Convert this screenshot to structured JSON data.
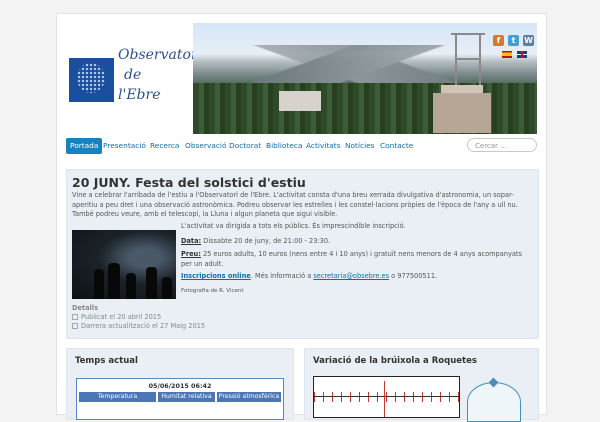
{
  "banner": {
    "logo_lines": [
      "Observatori",
      "de",
      "l'Ebre"
    ],
    "social": [
      {
        "icon": "facebook-icon",
        "glyph": "f",
        "color": "#d9772a"
      },
      {
        "icon": "twitter-icon",
        "glyph": "t",
        "color": "#3fa0d6"
      },
      {
        "icon": "wordpress-icon",
        "glyph": "W",
        "color": "#5a7f9e"
      }
    ],
    "languages": [
      {
        "icon": "flag-spanish-icon"
      },
      {
        "icon": "flag-english-icon"
      }
    ]
  },
  "nav": {
    "items": [
      "Portada",
      "Presentació",
      "Recerca",
      "Observació",
      "Doctorat",
      "Biblioteca",
      "Activitats",
      "Notícies",
      "Contacte"
    ],
    "active": "Portada",
    "search_placeholder": "Cercar ..."
  },
  "article": {
    "title": "20 JUNY. Festa del solstici d'estiu",
    "intro": "Vine a celebrar l'arribada de l'estiu a l'Observatori de l'Ebre. L'activitat consta d'una breu xerrada divulgativa d'astronomia, un sopar-aperitiu a peu dret i una observació astronòmica. Podreu observar les estrelles i les constel·lacions pròpies de l'època de l'any a ull nu. També podreu veure, amb el telescopi, la Lluna i algun planeta que sigui visible.",
    "line_public": "L'activitat va dirigida a tots els públics. És imprescindible inscripció.",
    "date_label": "Data:",
    "date_value": " Dissabte 20 de juny, de 21:00 - 23:30.",
    "price_label": "Preu:",
    "price_value": " 25 euros adults, 10 euros (nens entre 4 i 10 anys) i gratuït nens menors de 4 anys acompanyats per un adult.",
    "signup_link": "Inscripcions online",
    "signup_text_1": ". Més informació a ",
    "email": "secretaria@obsebre.es",
    "signup_text_2": " o 977500511.",
    "photo_credit": "Fotografia de R. Vicent",
    "details_label": "Detalls",
    "published": "Publicat el 20 abril 2015",
    "updated": "Darrera actualització el 27 Maig 2015"
  },
  "weather": {
    "title": "Temps actual",
    "date": "05/06/2015 06:42",
    "columns": [
      "Temperatura",
      "Humitat relativa",
      "Pressió atmosfèrica"
    ]
  },
  "compass": {
    "title": "Variació de la brúixola a Roquetes"
  }
}
